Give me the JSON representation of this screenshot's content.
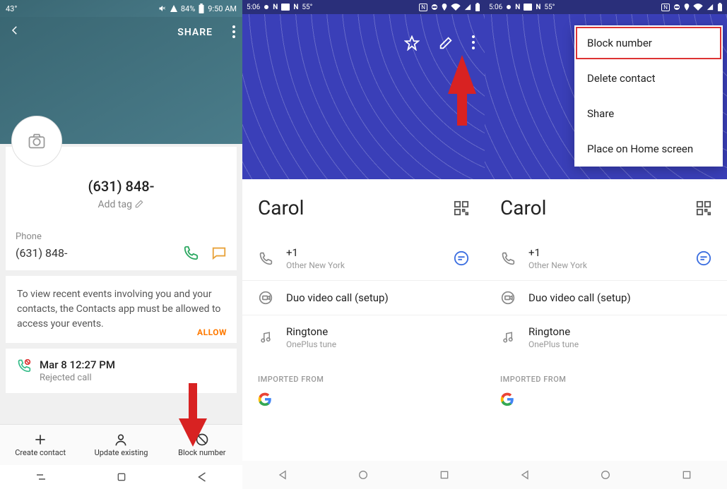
{
  "panel1": {
    "status": {
      "temp": "43°",
      "battery": "84%",
      "time": "9:50 AM"
    },
    "header": {
      "share": "SHARE"
    },
    "contact_number": "(631) 848-",
    "add_tag": "Add tag",
    "phone_label": "Phone",
    "phone_number": "(631) 848-",
    "events_text": "To view recent events involving you and your contacts, the Contacts app must be allowed to access your events.",
    "allow": "ALLOW",
    "recent": {
      "time": "Mar 8 12:27 PM",
      "type": "Rejected call"
    },
    "bottom": {
      "create": "Create contact",
      "update": "Update existing",
      "block": "Block number"
    }
  },
  "panel2": {
    "status": {
      "time": "5:06",
      "temp": "55°"
    },
    "name": "Carol",
    "phone": "+1",
    "phone_sub": "Other New York",
    "duo": "Duo video call (setup)",
    "ringtone": "Ringtone",
    "ringtone_sub": "OnePlus tune",
    "imported": "IMPORTED FROM"
  },
  "panel3": {
    "status": {
      "time": "5:06",
      "temp": "55°"
    },
    "name": "Carol",
    "phone": "+1",
    "phone_sub": "Other New York",
    "duo": "Duo video call (setup)",
    "ringtone": "Ringtone",
    "ringtone_sub": "OnePlus tune",
    "imported": "IMPORTED FROM",
    "menu": {
      "block": "Block number",
      "delete": "Delete contact",
      "share": "Share",
      "home": "Place on Home screen"
    }
  }
}
